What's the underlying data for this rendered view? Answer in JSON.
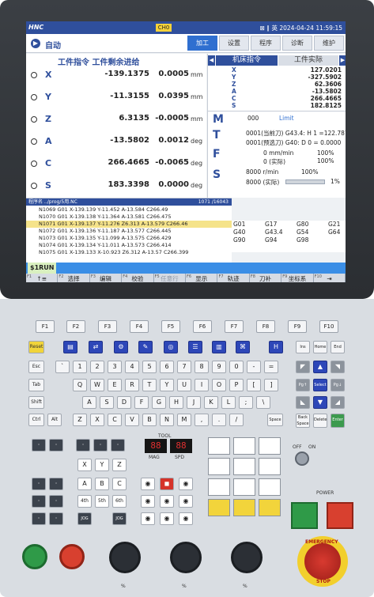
{
  "topbar": {
    "brand": "HNC",
    "channel": "CH0",
    "status": "⊠ ∥ 英",
    "datetime": "2024-04-24 11:59:15"
  },
  "mode": {
    "label": "自动"
  },
  "tabs": [
    {
      "label": "加工"
    },
    {
      "label": "设置"
    },
    {
      "label": "程序"
    },
    {
      "label": "诊断"
    },
    {
      "label": "维护"
    }
  ],
  "coords": {
    "header": "工件指令 工件剩余进给",
    "rows": [
      {
        "axis": "X",
        "command": "-139.1375",
        "remaining": "0.0005",
        "unit": "mm"
      },
      {
        "axis": "Y",
        "command": "-11.3155",
        "remaining": "0.0395",
        "unit": "mm"
      },
      {
        "axis": "Z",
        "command": "6.3135",
        "remaining": "-0.0005",
        "unit": "mm"
      },
      {
        "axis": "A",
        "command": "-13.5802",
        "remaining": "0.0012",
        "unit": "deg"
      },
      {
        "axis": "C",
        "command": "266.4665",
        "remaining": "-0.0065",
        "unit": "deg"
      },
      {
        "axis": "S",
        "command": "183.3398",
        "remaining": "0.0000",
        "unit": "deg"
      }
    ]
  },
  "machine": {
    "tab1": "机床指令",
    "tab2": "工件实际",
    "rows": [
      {
        "axis": "X",
        "value": "127.0201"
      },
      {
        "axis": "Y",
        "value": "-327.5902"
      },
      {
        "axis": "Z",
        "value": "62.3606"
      },
      {
        "axis": "A",
        "value": "-13.5802"
      },
      {
        "axis": "C",
        "value": "266.4665"
      },
      {
        "axis": "S",
        "value": "182.8125"
      }
    ]
  },
  "mtfs": {
    "m_letter": "M",
    "m_value": "000",
    "m_limit": "Limit",
    "t_letter": "T",
    "t_line1": "0001(当前刀) G43.4: H  1 =122.7873",
    "t_line2": "0001(预选刀)  G40: D  0 =   0.0000",
    "f_letter": "F",
    "f_line1": "0 mm/min",
    "f_pct1": "100%",
    "f_line2": "0 (实际)",
    "f_pct2": "100%",
    "s_letter": "S",
    "s_line1": "8000 r/min",
    "s_pct1": "100%",
    "s_line2": "8000 (实际)",
    "s_pct2": "1%"
  },
  "program": {
    "header_left": "程序名  ../prog/5用.NC",
    "header_right": "1071 /16043",
    "lines": [
      "N1069 G01 X-139.139 Y-11.452 A-13.584 C266.49",
      "N1070 G01 X-139.138 Y-11.364 A-13.581 C266.475",
      "N1071 G01 X-139.137 Y-11.276 Z6.313 A-13.579 C266.46",
      "N1072 G01 X-139.136 Y-11.187 A-13.577 C266.445",
      "N1073 G01 X-139.135 Y-11.099 A-13.575 C266.429",
      "N1074 G01 X-139.134 Y-11.011 A-13.573 C266.414",
      "N1075 G01 X-139.133 X-10.923 Z6.312 A-13.57 C266.399"
    ]
  },
  "gcodes": {
    "rows": [
      [
        "G01",
        "G17",
        "G80",
        "G21"
      ],
      [
        "G40",
        "G43.4",
        "G54",
        "G64"
      ],
      [
        "G90",
        "G94",
        "G98",
        ""
      ]
    ]
  },
  "run": {
    "label": "$1RUN"
  },
  "softkeys": [
    {
      "num": "F1",
      "label": "↑≡"
    },
    {
      "num": "F2",
      "label": "选择\n程序"
    },
    {
      "num": "F3",
      "label": "编辑\n程序"
    },
    {
      "num": "F4",
      "label": "校验"
    },
    {
      "num": "F5",
      "label": "任意行"
    },
    {
      "num": "F6",
      "label": "显示\n切换"
    },
    {
      "num": "F7",
      "label": "轨迹\n设置"
    },
    {
      "num": "F8",
      "label": "刀补"
    },
    {
      "num": "F9",
      "label": "坐标系"
    },
    {
      "num": "F10",
      "label": "⇥"
    }
  ],
  "fkeys": [
    "F1",
    "F2",
    "F3",
    "F4",
    "F5",
    "F6",
    "F7",
    "F8",
    "F9",
    "F10"
  ],
  "keyboard": {
    "row1": [
      "~",
      "!",
      "@",
      "#",
      "$",
      "%",
      "^",
      "&",
      "*",
      "(",
      ")",
      "_",
      "+"
    ],
    "row1b": [
      "`",
      "1",
      "2",
      "3",
      "4",
      "5",
      "6",
      "7",
      "8",
      "9",
      "0",
      "-",
      "="
    ],
    "row2": [
      "Q",
      "W",
      "E",
      "R",
      "T",
      "Y",
      "U",
      "I",
      "O",
      "P"
    ],
    "row3": [
      "A",
      "S",
      "D",
      "F",
      "G",
      "H",
      "J",
      "K",
      "L"
    ],
    "row4": [
      "Z",
      "X",
      "C",
      "V",
      "B",
      "N",
      "M"
    ],
    "left": [
      "Reset",
      "Esc",
      "Tab",
      "Shift",
      "Ctrl",
      "Alt"
    ],
    "right": [
      "Ins",
      "Home",
      "End",
      "Pg↑",
      "Select",
      "Pg↓",
      "Back Space",
      "Delete",
      "Enter",
      "Space"
    ]
  },
  "tool": {
    "label": "TOOL",
    "mag": "88",
    "spd": "88",
    "mag_label": "MAG",
    "spd_label": "SPD"
  },
  "axis_keys": [
    "X",
    "Y",
    "Z",
    "A",
    "B",
    "C",
    "4th",
    "5th",
    "6th"
  ],
  "power": {
    "off": "OFF",
    "on": "ON",
    "label": "POWER"
  },
  "estop": {
    "line1": "EMERGENCY",
    "line2": "STOP"
  },
  "knobs": {
    "k1": "%",
    "k2": "%",
    "k3": "%"
  }
}
